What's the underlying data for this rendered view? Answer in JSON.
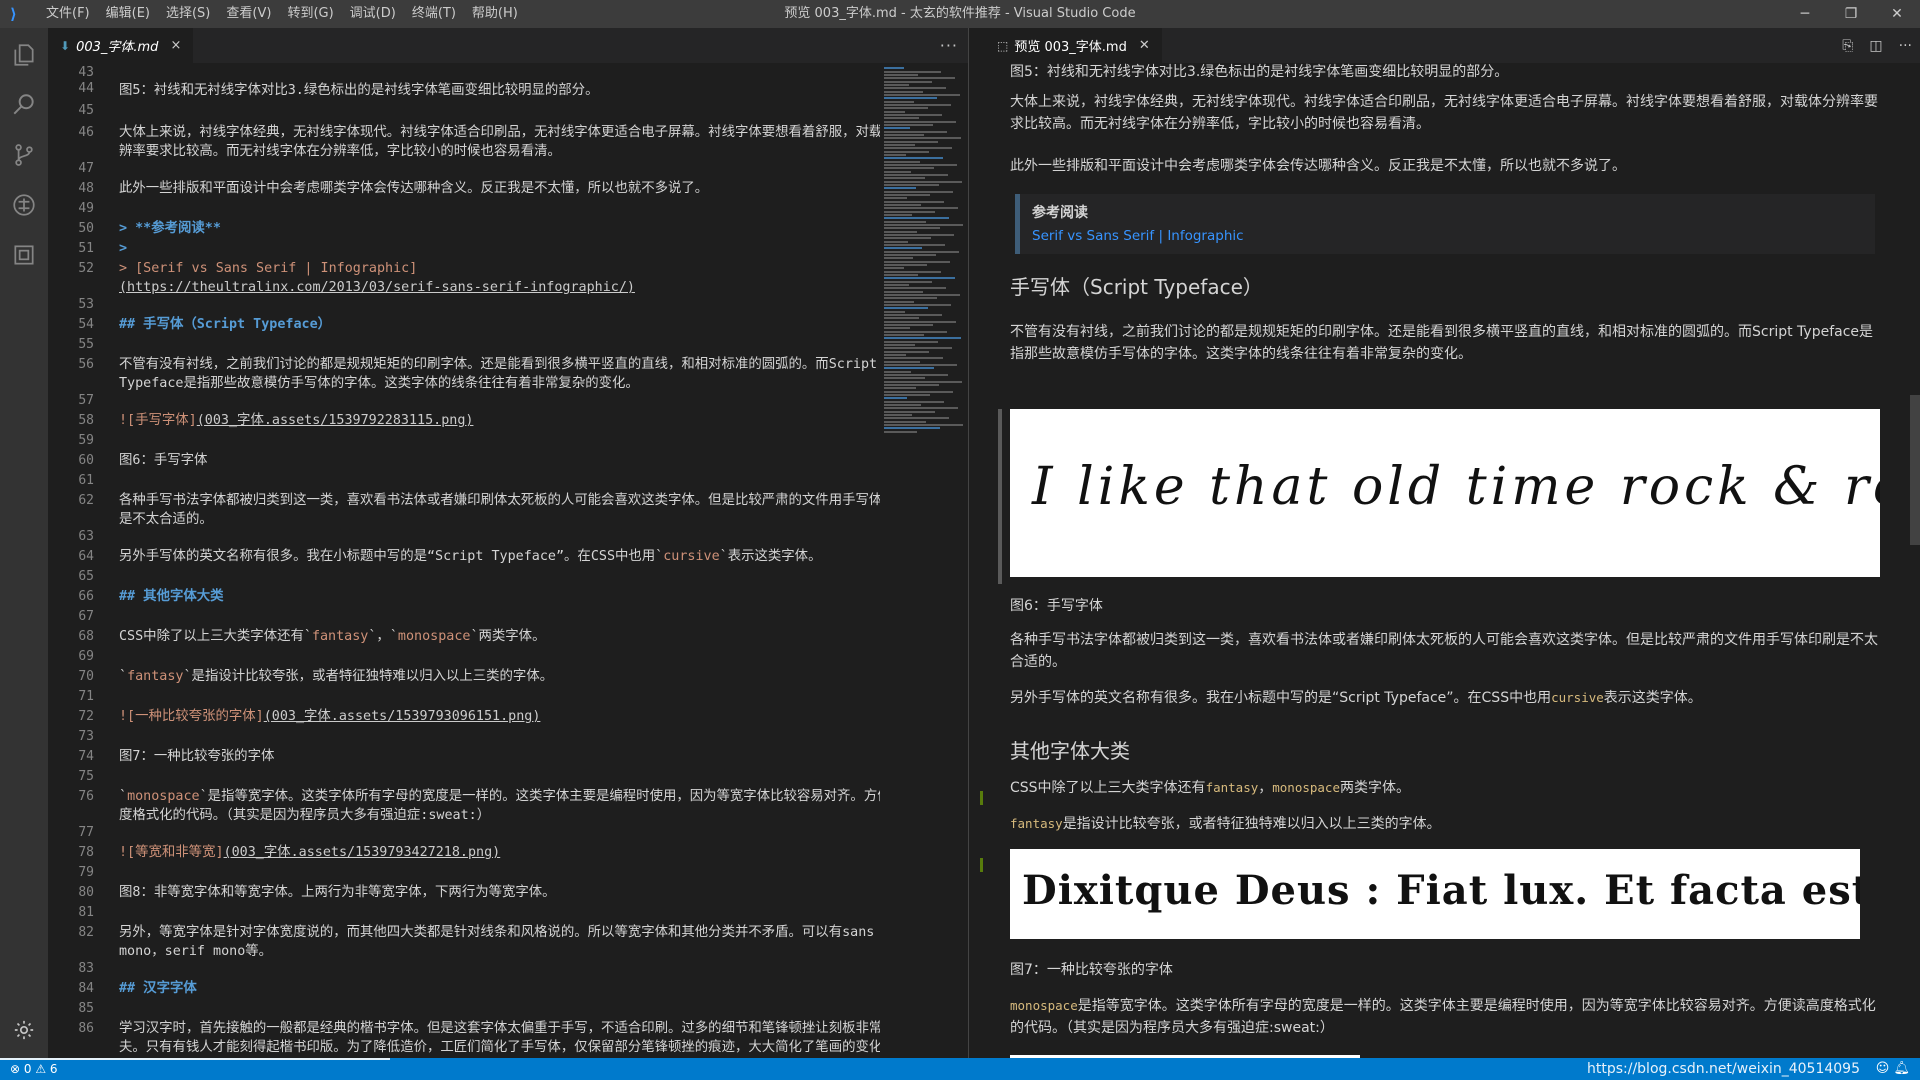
{
  "titlebar": {
    "menus": [
      "文件(F)",
      "编辑(E)",
      "选择(S)",
      "查看(V)",
      "转到(G)",
      "调试(D)",
      "终端(T)",
      "帮助(H)"
    ],
    "title": "预览 003_字体.md - 太玄的软件推荐 - Visual Studio Code",
    "minimize": "─",
    "restore": "❐",
    "close": "✕"
  },
  "left_tab": {
    "icon": "⬇",
    "label": "003_字体.md",
    "close": "×",
    "more": "···"
  },
  "right_tab": {
    "icon": "⬚",
    "label": "预览 003_字体.md",
    "close": "✕",
    "more": "···"
  },
  "code": {
    "n43": "43",
    "n44": "44",
    "n45": "45",
    "n46": "46",
    "n47": "47",
    "n48": "48",
    "n49": "49",
    "n50": "50",
    "n51": "51",
    "n52": "52",
    "n53": "53",
    "n54": "54",
    "n55": "55",
    "n56": "56",
    "n57": "57",
    "n58": "58",
    "n59": "59",
    "n60": "60",
    "n61": "61",
    "n62": "62",
    "n63": "63",
    "n64": "64",
    "n65": "65",
    "n66": "66",
    "n67": "67",
    "n68": "68",
    "n69": "69",
    "n70": "70",
    "n71": "71",
    "n72": "72",
    "n73": "73",
    "n74": "74",
    "n75": "75",
    "n76": "76",
    "n77": "77",
    "n78": "78",
    "n79": "79",
    "n80": "80",
    "n81": "81",
    "n82": "82",
    "n83": "83",
    "n84": "84",
    "n85": "85",
    "n86": "86",
    "l44": "图5：衬线和无衬线字体对比3.绿色标出的是衬线字体笔画变细比较明显的部分。",
    "l46": "大体上来说，衬线字体经典，无衬线字体现代。衬线字体适合印刷品，无衬线字体更适合电子屏幕。衬线字体要想看着舒服，对载体分辨率要求比较高。而无衬线字体在分辨率低，字比较小的时候也容易看清。",
    "l48": "此外一些排版和平面设计中会考虑哪类字体会传达哪种含义。反正我是不太懂，所以也就不多说了。",
    "l50": "> **参考阅读**",
    "l51": ">",
    "l52a": "> [Serif vs Sans Serif | Infographic]",
    "l52b": "(https://theultralinx.com/2013/03/serif-sans-serif-infographic/)",
    "l54": "## 手写体（Script Typeface）",
    "l56": "不管有没有衬线，之前我们讨论的都是规规矩矩的印刷字体。还是能看到很多横平竖直的直线，和相对标准的圆弧的。而Script Typeface是指那些故意模仿手写体的字体。这类字体的线条往往有着非常复杂的变化。",
    "l58a": "![手写字体]",
    "l58b": "(003_字体.assets/1539792283115.png)",
    "l60": "图6：手写字体",
    "l62": "各种手写书法字体都被归类到这一类，喜欢看书法体或者嫌印刷体太死板的人可能会喜欢这类字体。但是比较严肃的文件用手写体印刷是不太合适的。",
    "l64a": "另外手写体的英文名称有很多。我在小标题中写的是“Script Typeface”。在CSS中也用`",
    "l64b": "cursive",
    "l64c": "`表示这类字体。",
    "l66": "## 其他字体大类",
    "l68a": "CSS中除了以上三大类字体还有`",
    "l68b": "fantasy",
    "l68c": "`，`",
    "l68d": "monospace",
    "l68e": "`两类字体。",
    "l70a": "`",
    "l70b": "fantasy",
    "l70c": "`是指设计比较夸张，或者特征独特难以归入以上三类的字体。",
    "l72a": "![一种比较夸张的字体]",
    "l72b": "(003_字体.assets/1539793096151.png)",
    "l74": "图7：一种比较夸张的字体",
    "l76a": "`",
    "l76b": "monospace",
    "l76c": "`是指等宽字体。这类字体所有字母的宽度是一样的。这类字体主要是编程时使用，因为等宽字体比较容易对齐。方便读高度格式化的代码。（其实是因为程序员大多有强迫症:sweat:）",
    "l78a": "![等宽和非等宽]",
    "l78b": "(003_字体.assets/1539793427218.png)",
    "l80": "图8：非等宽字体和等宽字体。上两行为非等宽字体，下两行为等宽字体。",
    "l82": "另外，等宽字体是针对字体宽度说的，而其他四大类都是针对线条和风格说的。所以等宽字体和其他分类并不矛盾。可以有sans mono，serif mono等。",
    "l84": "## 汉字字体",
    "l86": "学习汉字时，首先接触的一般都是经典的楷书字体。但是这套字体太偏重于手写，不适合印刷。过多的细节和笔锋顿挫让刻板非常费工夫。只有有钱人才能刻得起楷书印版。为了降低造价，工匠们简化了手写体，仅保留部分笔锋顿挫的痕迹，大大简化了笔画的变化，形成了专用的印刷字体——宋体。"
  },
  "preview": {
    "p1": "图5：衬线和无衬线字体对比3.绿色标出的是衬线字体笔画变细比较明显的部分。",
    "p2": "大体上来说，衬线字体经典，无衬线字体现代。衬线字体适合印刷品，无衬线字体更适合电子屏幕。衬线字体要想看着舒服，对载体分辨率要求比较高。而无衬线字体在分辨率低，字比较小的时候也容易看清。",
    "p3": "此外一些排版和平面设计中会考虑哪类字体会传达哪种含义。反正我是不太懂，所以也就不多说了。",
    "bq_title": "参考阅读",
    "bq_link": "Serif vs Sans Serif | Infographic",
    "h_script": "手写体（Script Typeface）",
    "p4": "不管有没有衬线，之前我们讨论的都是规规矩矩的印刷字体。还是能看到很多横平竖直的直线，和相对标准的圆弧的。而Script Typeface是指那些故意模仿手写体的字体。这类字体的线条往往有着非常复杂的变化。",
    "img1_text": "I like that old time rock & roll.",
    "cap6": "图6：手写字体",
    "p5": "各种手写书法字体都被归类到这一类，喜欢看书法体或者嫌印刷体太死板的人可能会喜欢这类字体。但是比较严肃的文件用手写体印刷是不太合适的。",
    "p6a": "另外手写体的英文名称有很多。我在小标题中写的是“Script Typeface”。在CSS中也用",
    "p6b": "cursive",
    "p6c": "表示这类字体。",
    "h_other": "其他字体大类",
    "p7a": "CSS中除了以上三大类字体还有",
    "p7b": "fantasy",
    "p7c": "，",
    "p7d": "monospace",
    "p7e": "两类字体。",
    "p8a": "fantasy",
    "p8b": "是指设计比较夸张，或者特征独特难以归入以上三类的字体。",
    "img2_text": "Dixitque Deus : Fiat lux. Et facta est lux.",
    "cap7": "图7：一种比较夸张的字体",
    "p9a": "monospace",
    "p9b": "是指等宽字体。这类字体所有字母的宽度是一样的。这类字体主要是编程时使用，因为等宽字体比较容易对齐。方便读高度格式化的代码。（其实是因为程序员大多有强迫症:sweat:）"
  },
  "statusbar": {
    "errors": "⊗ 0",
    "warnings": "⚠ 6",
    "watermark": "https://blog.csdn.net/weixin_40514095"
  },
  "colors": {
    "accent": "#007acc",
    "heading": "#569cd6",
    "link": "#3794ff",
    "string": "#ce9178",
    "quote": "#6a9955",
    "inline_code": "#d7ba7d"
  }
}
